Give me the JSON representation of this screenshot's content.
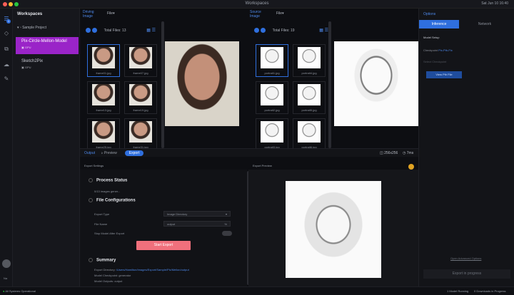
{
  "window": {
    "title": "Workspaces",
    "clock": "Sat Jun 10 16:40"
  },
  "rail": {
    "badge": "1",
    "bottom_label": "Na",
    "avatar": ""
  },
  "workspaces": {
    "header": "Workspaces",
    "project": "Sample Project",
    "items": [
      {
        "name": "Pix-Circle-Mellon-Model",
        "sub": "GPU"
      },
      {
        "name": "Sketch2Pix",
        "sub": "GPU"
      }
    ]
  },
  "driving": {
    "label_line1": "Driving",
    "label_line2": "Image",
    "file_menu": "File",
    "total": "Total Files: 13",
    "thumbs": [
      {
        "name": "frame01.jpg"
      },
      {
        "name": "frame07.jpg"
      },
      {
        "name": "frame13.jpg"
      },
      {
        "name": "frame19.jpg"
      },
      {
        "name": "frame25.jpg"
      },
      {
        "name": "frame31.jpg"
      }
    ]
  },
  "source": {
    "label_line1": "Source",
    "label_line2": "Image",
    "file_menu": "File",
    "total": "Total Files: 19",
    "thumbs": [
      {
        "name": "portrait1.jpg"
      },
      {
        "name": "portrait4.jpg"
      },
      {
        "name": "portrait2.jpg"
      },
      {
        "name": "portrait5.jpg"
      },
      {
        "name": "portrait3.jpg"
      },
      {
        "name": "portrait6.jpg"
      }
    ]
  },
  "bottombar": {
    "output": "Output",
    "preview": "Preview",
    "export": "Export",
    "resolution": "256x256",
    "duration": "7ms"
  },
  "settings": {
    "label": "Export Settings",
    "process_status": "Process Status",
    "process_text": "0/13 images gener...",
    "file_config": "File Configurations",
    "export_type_label": "Export Type",
    "export_type_value": "Image Directory",
    "file_name_label": "File Name",
    "file_name_value": "output",
    "stop_label": "Stop Model After Export",
    "start_button": "Start Export",
    "summary": "Summary",
    "export_dir_label": "Export Directory:",
    "export_dir_value": "/Users/Hamilton/Images/Export/Sample/Pix/Mellon/output",
    "model_checkpoint": "Model Checkpoint: generator",
    "model_outputs": "Model Outputs: output"
  },
  "preview": {
    "label": "Export Preview"
  },
  "sidebar": {
    "title": "Options",
    "tab_left": "Inference",
    "tab_right": "Network",
    "model_setup": "Model Setup",
    "checkpoint_label": "Checkpoint",
    "checkpoint_value": "Pix-Pth-Fix",
    "extra_label": "Select Checkpoint",
    "view_button": "View Pth File",
    "footer_link": "Open Advanced Options",
    "export_progress": "Export in progress"
  },
  "status": {
    "left": "All Systems Operational",
    "right_1": "1 Model Running",
    "right_2": "0 Downloads in Progress"
  },
  "colors": {
    "accent": "#2f6fde",
    "active": "#9a24c8",
    "start": "#f0707c"
  }
}
